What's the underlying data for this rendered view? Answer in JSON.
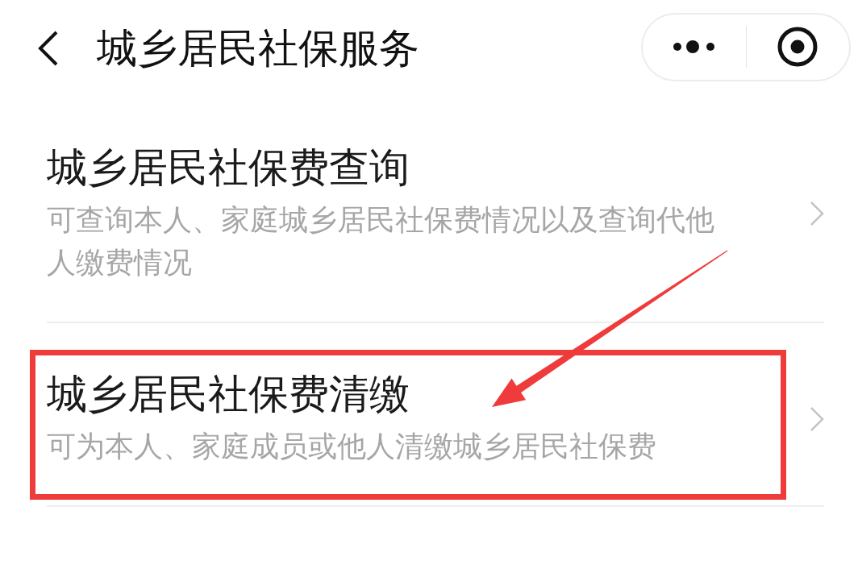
{
  "header": {
    "title": "城乡居民社保服务"
  },
  "items": [
    {
      "title": "城乡居民社保费查询",
      "description": "可查询本人、家庭城乡居民社保费情况以及查询代他人缴费情况",
      "highlighted": false
    },
    {
      "title": "城乡居民社保费清缴",
      "description": "可为本人、家庭成员或他人清缴城乡居民社保费",
      "highlighted": true
    }
  ]
}
